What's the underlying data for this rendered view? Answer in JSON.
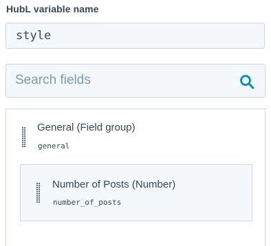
{
  "variable_name": {
    "label": "HubL variable name",
    "value": "style"
  },
  "search": {
    "placeholder": "Search fields",
    "icon": "search-icon"
  },
  "field_group": {
    "title": "General (Field group)",
    "variable": "general",
    "fields": [
      {
        "title": "Number of Posts (Number)",
        "variable": "number_of_posts"
      }
    ]
  },
  "colors": {
    "text": "#33475b",
    "placeholder": "#7c98b6",
    "input_bg": "#f5f8fa",
    "border": "#cbd6e2",
    "accent": "#0091ae"
  }
}
